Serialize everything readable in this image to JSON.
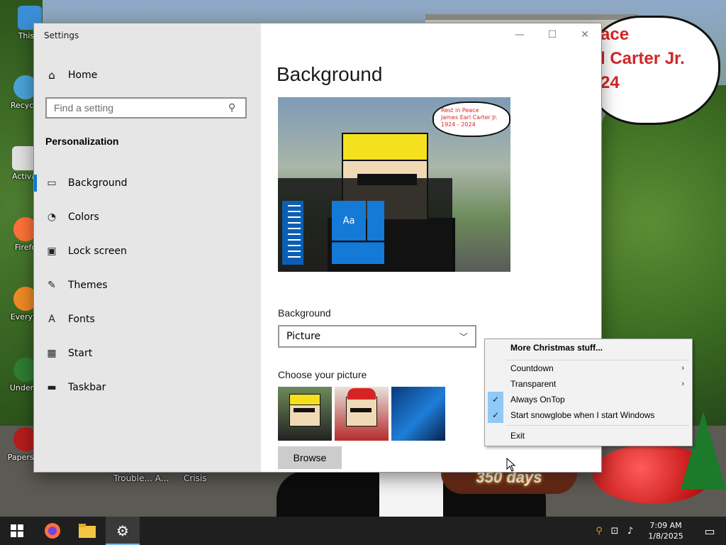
{
  "desktop": {
    "icons": [
      {
        "label": "This P",
        "color": "#3a8fd6"
      },
      {
        "label": "Recycle",
        "color": "#4aa3d8"
      },
      {
        "label": "Activa",
        "color": "#e0e0e0"
      },
      {
        "label": "Firefo",
        "color": "#ff7139"
      },
      {
        "label": "Everyth",
        "color": "#f08a24"
      },
      {
        "label": "Underta",
        "color": "#2e7d32"
      },
      {
        "label": "Papers, P",
        "color": "#b71c1c"
      }
    ],
    "bottom_labels": [
      "Trouble... A...",
      "Crisis"
    ],
    "wallpaper_bubble": [
      "ace",
      "l Carter Jr.",
      "24"
    ]
  },
  "settings": {
    "window_title": "Settings",
    "nav_home": "Home",
    "search_placeholder": "Find a setting",
    "section_title": "Personalization",
    "nav_items": [
      {
        "label": "Background",
        "icon": "picture-icon",
        "glyph": "▭",
        "active": true
      },
      {
        "label": "Colors",
        "icon": "palette-icon",
        "glyph": "◔",
        "active": false
      },
      {
        "label": "Lock screen",
        "icon": "lock-screen-icon",
        "glyph": "▣",
        "active": false
      },
      {
        "label": "Themes",
        "icon": "brush-icon",
        "glyph": "✎",
        "active": false
      },
      {
        "label": "Fonts",
        "icon": "fonts-icon",
        "glyph": "A",
        "active": false
      },
      {
        "label": "Start",
        "icon": "start-icon",
        "glyph": "▦",
        "active": false
      },
      {
        "label": "Taskbar",
        "icon": "taskbar-icon",
        "glyph": "▬",
        "active": false
      }
    ],
    "page_title": "Background",
    "preview": {
      "bubble_lines": [
        "Rest in Peace",
        "James Earl Carter Jr.",
        "1924 - 2024"
      ],
      "tile_text": "Aa"
    },
    "background_label": "Background",
    "background_value": "Picture",
    "choose_label": "Choose your picture",
    "browse_label": "Browse",
    "accent_color": "#0078d7"
  },
  "snowglobe": {
    "days_text": "350 days"
  },
  "context_menu": {
    "items": [
      {
        "label": "More Christmas stuff...",
        "bold": true,
        "checked": false,
        "submenu": false
      },
      {
        "label": "Countdown",
        "bold": false,
        "checked": false,
        "submenu": true
      },
      {
        "label": "Transparent",
        "bold": false,
        "checked": false,
        "submenu": true
      },
      {
        "label": "Always OnTop",
        "bold": false,
        "checked": true,
        "submenu": false
      },
      {
        "label": "Start snowglobe when I start Windows",
        "bold": false,
        "checked": true,
        "submenu": false
      },
      {
        "label": "Exit",
        "bold": false,
        "checked": false,
        "submenu": false
      }
    ]
  },
  "taskbar": {
    "time": "7:09 AM",
    "date": "1/8/2025"
  }
}
